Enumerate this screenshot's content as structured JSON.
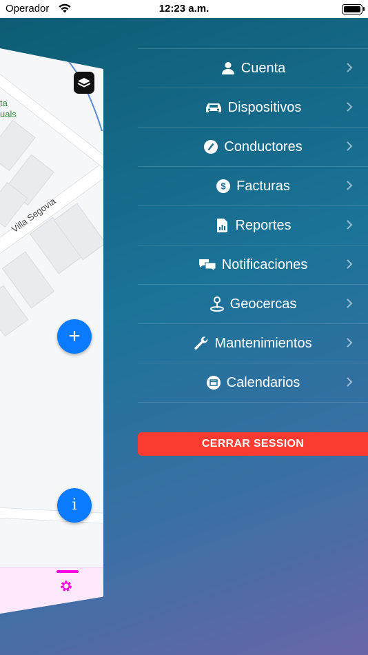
{
  "status_bar": {
    "carrier": "Operador",
    "time": "12:23 a.m."
  },
  "map": {
    "park_label_line1": "ta",
    "park_label_line2": "uals",
    "street_label": "Villa Segovia",
    "add_button": "+",
    "info_button": "i"
  },
  "menu": {
    "items": [
      {
        "label": "Cuenta",
        "icon": "person-icon"
      },
      {
        "label": "Dispositivos",
        "icon": "car-icon"
      },
      {
        "label": "Conductores",
        "icon": "compass-icon"
      },
      {
        "label": "Facturas",
        "icon": "dollar-icon"
      },
      {
        "label": "Reportes",
        "icon": "report-icon"
      },
      {
        "label": "Notificaciones",
        "icon": "comments-icon"
      },
      {
        "label": "Geocercas",
        "icon": "map-pin-icon"
      },
      {
        "label": "Mantenimientos",
        "icon": "wrench-icon"
      },
      {
        "label": "Calendarios",
        "icon": "calendar-icon"
      }
    ]
  },
  "logout_label": "CERRAR SESSION",
  "colors": {
    "accent": "#0a7bff",
    "danger": "#fb3b30",
    "tab_active": "#ff00e0"
  }
}
